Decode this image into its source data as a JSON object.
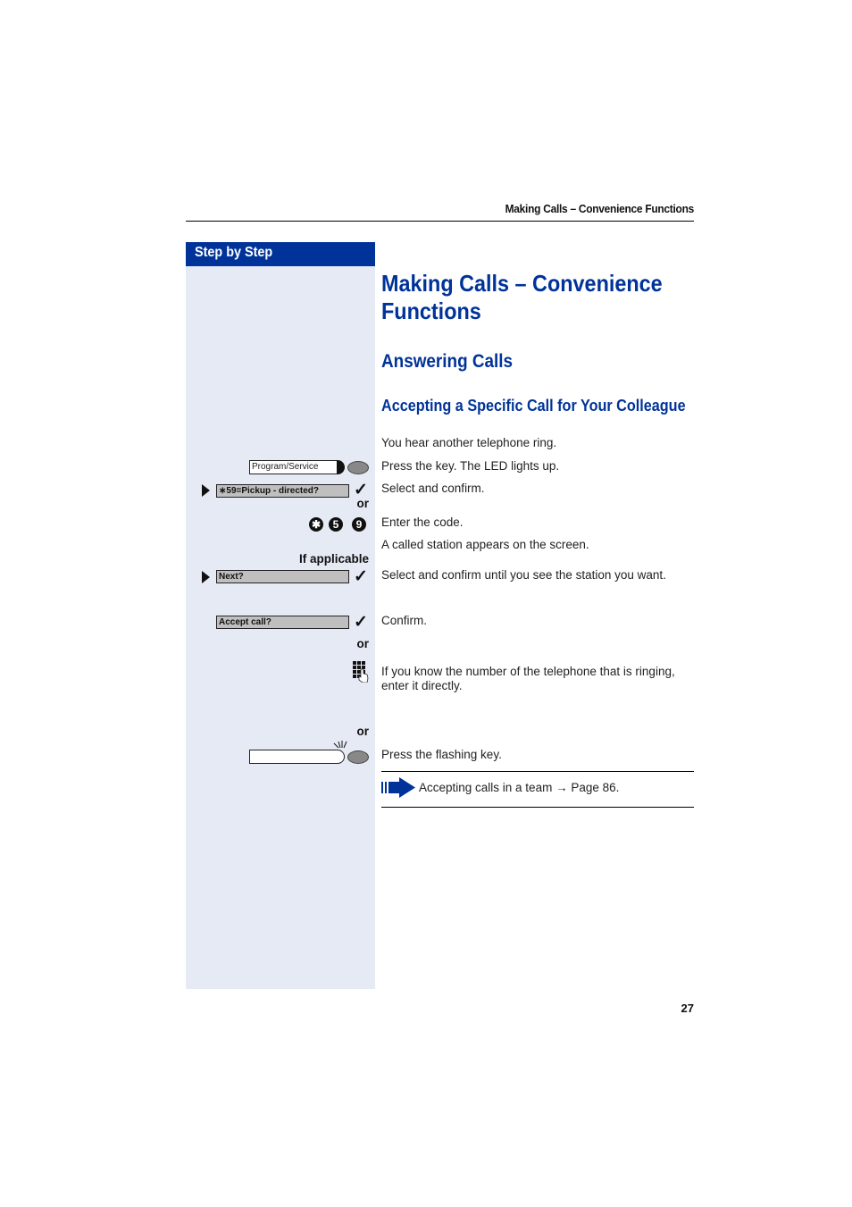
{
  "running_header": "Making Calls – Convenience Functions",
  "sidebar": {
    "title": "Step by Step"
  },
  "headings": {
    "h1": "Making Calls – Convenience\nFunctions",
    "h2": "Answering Calls",
    "h3": "Accepting a Specific Call for Your Colleague"
  },
  "steps": {
    "intro": "You hear another telephone ring.",
    "program_key_label": "Program/Service",
    "program_key_text": "Press the key. The LED lights up.",
    "pickup_display": "∗59=Pickup - directed?",
    "pickup_text": "Select and confirm.",
    "or_1": "or",
    "code_digits": [
      "✱",
      "5",
      "9"
    ],
    "code_text": "Enter the code.",
    "station_text": "A called station appears on the screen.",
    "if_applicable": "If applicable",
    "next_display": "Next?",
    "next_text": "Select and confirm until you see the station you want.",
    "accept_display": "Accept call?",
    "accept_text": "Confirm.",
    "or_2": "or",
    "keypad_text": "If you know the number of the telephone that is ringing, enter it directly.",
    "or_3": "or",
    "flashing_text": "Press the flashing key.",
    "check_glyph": "✓"
  },
  "note": {
    "text": "Accepting calls in a team",
    "arrow": "→",
    "page_ref": "Page 86."
  },
  "page_number": "27"
}
